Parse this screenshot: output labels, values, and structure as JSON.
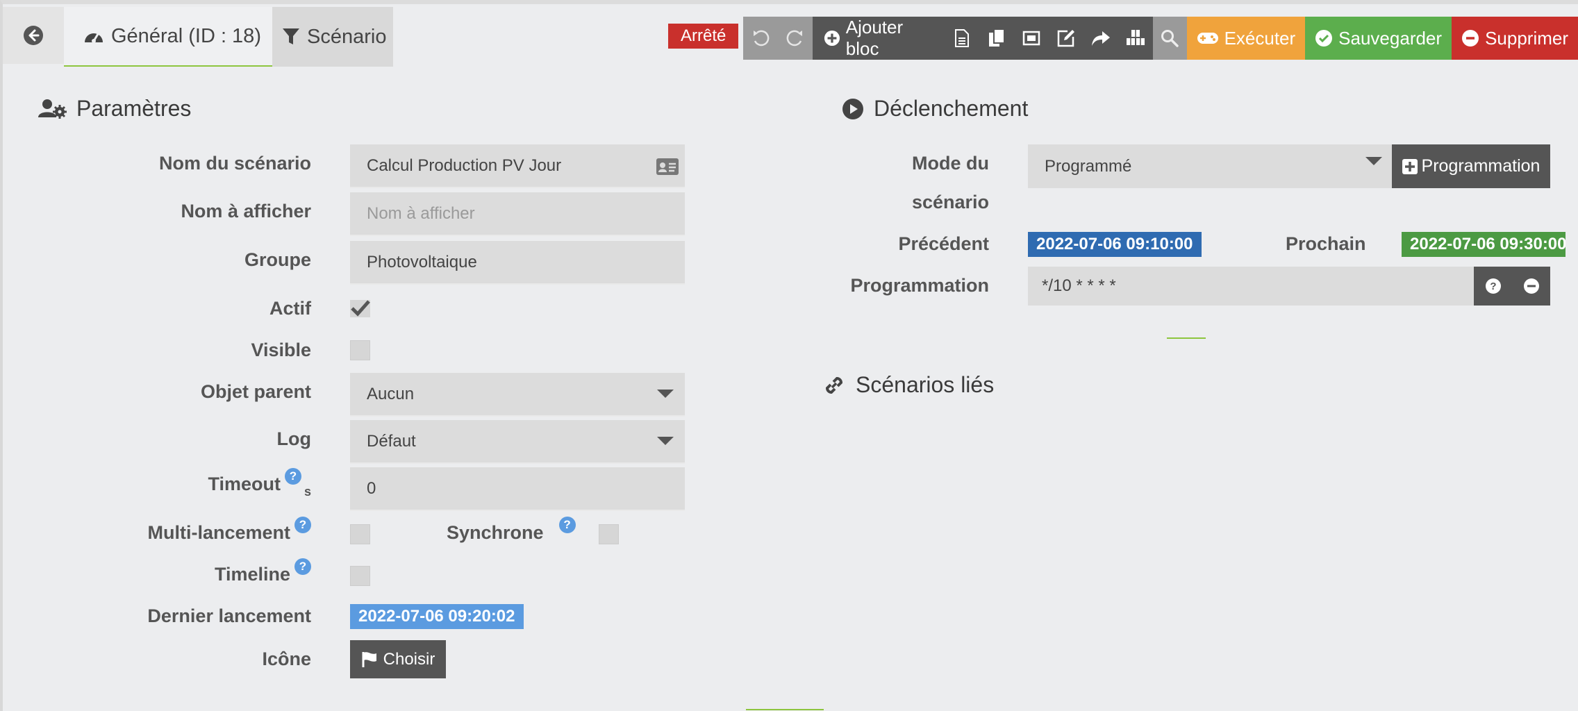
{
  "tabs": {
    "general_label": "Général (ID : 18)",
    "scenario_label": "Scénario"
  },
  "status": {
    "label": "Arrêté",
    "color": "#c9302c"
  },
  "toolbar": {
    "add_block_label": "Ajouter bloc",
    "execute_label": "Exécuter",
    "save_label": "Sauvegarder",
    "delete_label": "Supprimer"
  },
  "parameters": {
    "title": "Paramètres",
    "name_label": "Nom du scénario",
    "name_value": "Calcul Production PV Jour",
    "display_name_label": "Nom à afficher",
    "display_name_placeholder": "Nom à afficher",
    "group_label": "Groupe",
    "group_value": "Photovoltaique",
    "active_label": "Actif",
    "active_checked": true,
    "visible_label": "Visible",
    "visible_checked": false,
    "parent_label": "Objet parent",
    "parent_value": "Aucun",
    "log_label": "Log",
    "log_value": "Défaut",
    "timeout_label": "Timeout",
    "timeout_unit": "s",
    "timeout_value": "0",
    "multi_label": "Multi-lancement",
    "sync_label": "Synchrone",
    "timeline_label": "Timeline",
    "last_run_label": "Dernier lancement",
    "last_run_value": "2022-07-06 09:20:02",
    "icon_label": "Icône",
    "choose_label": "Choisir"
  },
  "trigger": {
    "title": "Déclenchement",
    "mode_label_line1": "Mode du",
    "mode_label_line2": "scénario",
    "mode_value": "Programmé",
    "programmation_button": "Programmation",
    "previous_label": "Précédent",
    "previous_value": "2022-07-06 09:10:00",
    "next_label": "Prochain",
    "next_value": "2022-07-06 09:30:00",
    "cron_label": "Programmation",
    "cron_value": "*/10 * * * *"
  },
  "linked": {
    "title": "Scénarios liés"
  },
  "colors": {
    "accent_green": "#8dc53e",
    "execute": "#f0a33c",
    "save": "#5cae4d",
    "delete": "#c9302c",
    "badge_previous": "#2f6bb1",
    "badge_next": "#4c9a43",
    "badge_last_run": "#5b9be0"
  }
}
